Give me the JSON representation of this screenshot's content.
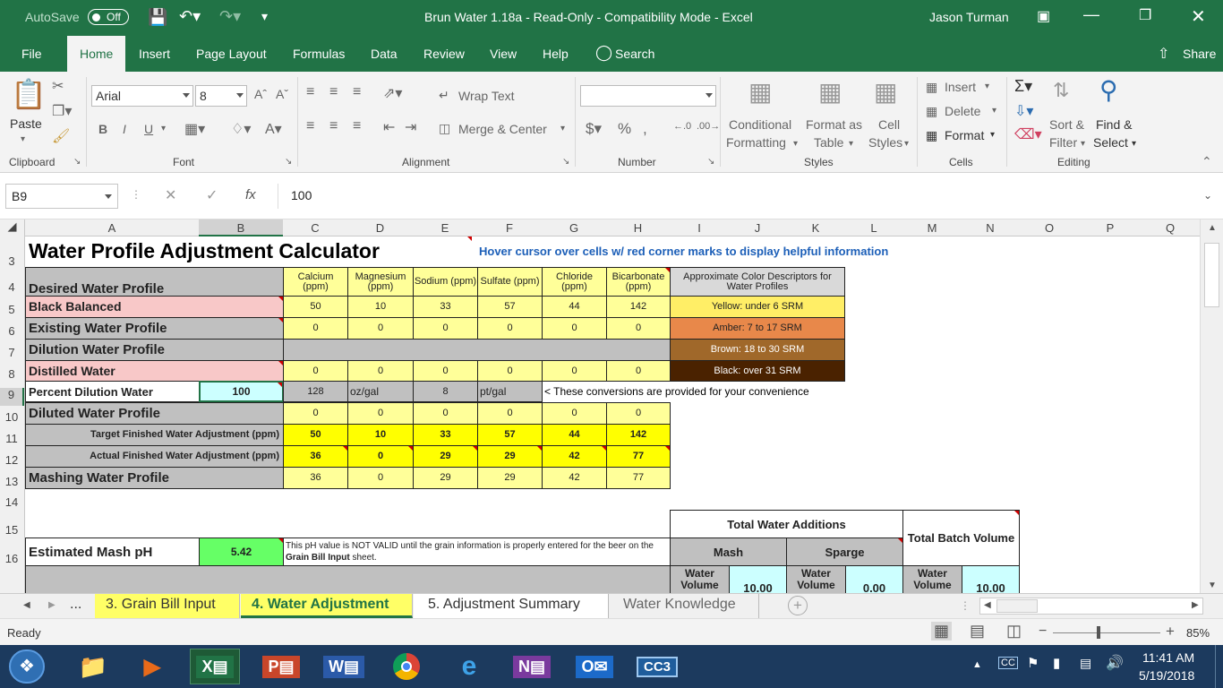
{
  "titlebar": {
    "autosave_label": "AutoSave",
    "autosave_state": "Off",
    "title": "Brun Water 1.18a  -  Read-Only  -  Compatibility Mode  -  Excel",
    "user": "Jason Turman"
  },
  "tabs": [
    "File",
    "Home",
    "Insert",
    "Page Layout",
    "Formulas",
    "Data",
    "Review",
    "View",
    "Help"
  ],
  "search_label": "Search",
  "share_label": "Share",
  "ribbon": {
    "paste": "Paste",
    "clipboard": "Clipboard",
    "font_name": "Arial",
    "font_size": "8",
    "font_group": "Font",
    "wrap_text": "Wrap Text",
    "merge_center": "Merge & Center",
    "alignment": "Alignment",
    "number": "Number",
    "conditional_1": "Conditional",
    "conditional_2": "Formatting",
    "format_as_1": "Format as",
    "format_as_2": "Table",
    "cell_styles_1": "Cell",
    "cell_styles_2": "Styles",
    "styles": "Styles",
    "insert": "Insert",
    "delete": "Delete",
    "format": "Format",
    "cells": "Cells",
    "sort_1": "Sort &",
    "sort_2": "Filter",
    "find_1": "Find &",
    "find_2": "Select",
    "editing": "Editing"
  },
  "formula_bar": {
    "name_box": "B9",
    "fx": "fx",
    "value": "100"
  },
  "columns": [
    "A",
    "B",
    "C",
    "D",
    "E",
    "F",
    "G",
    "H",
    "I",
    "J",
    "K",
    "L",
    "M",
    "N",
    "O",
    "P",
    "Q"
  ],
  "rows": [
    "3",
    "4",
    "5",
    "6",
    "7",
    "8",
    "9",
    "10",
    "11",
    "12",
    "13",
    "14",
    "15",
    "16"
  ],
  "sheet": {
    "title": "Water Profile Adjustment Calculator",
    "hover_note": "Hover cursor over cells w/ red corner marks to display helpful information",
    "headers": [
      "Calcium (ppm)",
      "Magnesium (ppm)",
      "Sodium (ppm)",
      "Sulfate (ppm)",
      "Chloride (ppm)",
      "Bicarbonate (ppm)"
    ],
    "color_header": "Approximate Color Descriptors for Water Profiles",
    "colors": [
      {
        "label": "Yellow: under 6 SRM",
        "bg": "#ffee66"
      },
      {
        "label": "Amber: 7 to 17 SRM",
        "bg": "#e8884a"
      },
      {
        "label": "Brown: 18 to 30 SRM",
        "bg": "#a0682a"
      },
      {
        "label": "Black: over 31 SRM",
        "bg": "#4a2200"
      }
    ],
    "desired_label": "Desired Water Profile",
    "black_balanced": "Black Balanced",
    "black_values": [
      "50",
      "10",
      "33",
      "57",
      "44",
      "142"
    ],
    "existing_label": "Existing Water Profile",
    "existing_values": [
      "0",
      "0",
      "0",
      "0",
      "0",
      "0"
    ],
    "dilution_label": "Dilution Water Profile",
    "distilled_label": "Distilled Water",
    "distilled_values": [
      "0",
      "0",
      "0",
      "0",
      "0",
      "0"
    ],
    "percent_label": "Percent Dilution Water",
    "percent_value": "100",
    "conv": {
      "c": "128",
      "d": "oz/gal",
      "e": "8",
      "f": "pt/gal"
    },
    "conv_note": "< These conversions are provided for your convenience",
    "diluted_label": "Diluted Water Profile",
    "diluted_values": [
      "0",
      "0",
      "0",
      "0",
      "0",
      "0"
    ],
    "target_label": "Target Finished Water Adjustment (ppm)",
    "target_values": [
      "50",
      "10",
      "33",
      "57",
      "44",
      "142"
    ],
    "actual_label": "Actual Finished Water Adjustment (ppm)",
    "actual_values": [
      "36",
      "0",
      "29",
      "29",
      "42",
      "77"
    ],
    "mashing_label": "Mashing Water Profile",
    "mashing_values": [
      "36",
      "0",
      "29",
      "29",
      "42",
      "77"
    ],
    "mash_ph_label": "Estimated Mash pH",
    "mash_ph_value": "5.42",
    "ph_note_1": "This pH value is NOT VALID until the grain information is properly entered for the beer on the",
    "ph_note_2": "Grain Bill Input",
    "ph_note_3": " sheet.",
    "total_additions": "Total Water Additions",
    "mash": "Mash",
    "sparge": "Sparge",
    "total_batch": "Total Batch Volume",
    "water_volume": "Water Volume",
    "mash_volume": "10.00",
    "sparge_volume": "0.00",
    "batch_volume": "10.00"
  },
  "sheet_tabs": [
    "...",
    "3. Grain Bill Input",
    "4. Water Adjustment",
    "5. Adjustment Summary",
    "Water Knowledge"
  ],
  "status": {
    "ready": "Ready",
    "zoom": "85%"
  },
  "taskbar": {
    "time": "11:41 AM",
    "date": "5/19/2018"
  },
  "colors": {
    "excel_green": "#217346",
    "pale_yellow": "#ffff99",
    "bright_yellow": "#ffff00",
    "pink": "#f8c8c8",
    "gray": "#c0c0c0",
    "ph_green": "#66ff66",
    "light_cyan": "#ccffff"
  }
}
